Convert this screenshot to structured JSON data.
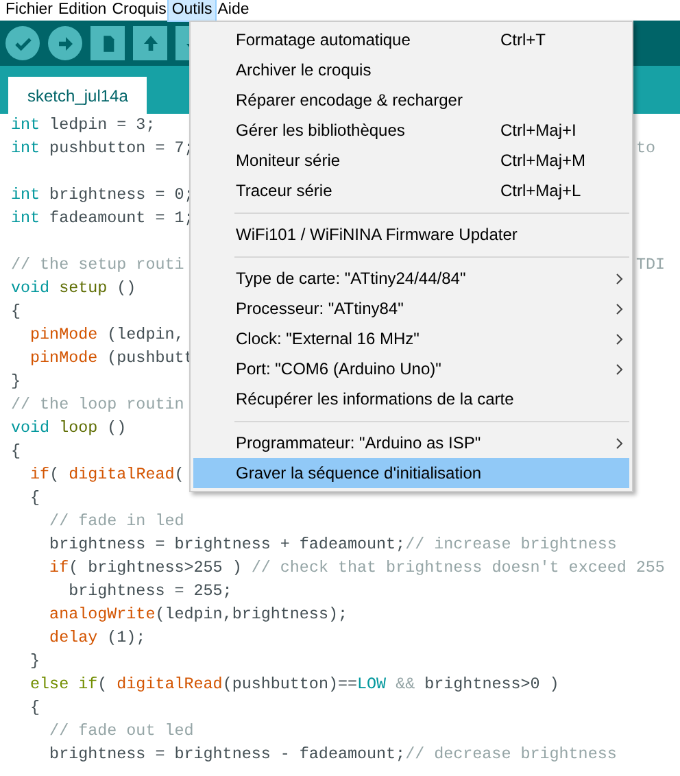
{
  "menubar": [
    {
      "label": "Fichier",
      "selected": false
    },
    {
      "label": "Edition",
      "selected": false
    },
    {
      "label": "Croquis",
      "selected": false
    },
    {
      "label": "Outils",
      "selected": true
    },
    {
      "label": "Aide",
      "selected": false
    }
  ],
  "toolbar": [
    {
      "kind": "verify"
    },
    {
      "kind": "upload"
    },
    {
      "kind": "new"
    },
    {
      "kind": "open"
    },
    {
      "kind": "save"
    }
  ],
  "tabs": [
    {
      "label": "sketch_jul14a",
      "selected": true
    }
  ],
  "code": [
    {
      "kind": "code",
      "left": [
        {
          "text": "int",
          "kind": "type"
        },
        {
          "text": " ledpin = 3;",
          "kind": "plain"
        }
      ]
    },
    {
      "kind": "code",
      "left": [
        {
          "text": "int",
          "kind": "type"
        },
        {
          "text": " pushbutton = 7;",
          "kind": "plain"
        }
      ],
      "right": [
        {
          "text": "to",
          "kind": "comment"
        }
      ]
    },
    {
      "kind": "blank"
    },
    {
      "kind": "code",
      "left": [
        {
          "text": "int",
          "kind": "type"
        },
        {
          "text": " brightness = 0;",
          "kind": "plain"
        }
      ]
    },
    {
      "kind": "code",
      "left": [
        {
          "text": "int",
          "kind": "type"
        },
        {
          "text": " fadeamount = 1;",
          "kind": "plain"
        }
      ]
    },
    {
      "kind": "blank"
    },
    {
      "kind": "code",
      "left": [
        {
          "text": "// the setup routi",
          "kind": "comment"
        }
      ],
      "right": [
        {
          "text": "TDI",
          "kind": "comment"
        }
      ]
    },
    {
      "kind": "code",
      "left": [
        {
          "text": "void ",
          "kind": "type"
        },
        {
          "text": "setup",
          "kind": "func"
        },
        {
          "text": " ()",
          "kind": "plain"
        }
      ]
    },
    {
      "kind": "code",
      "left": [
        {
          "text": "{",
          "kind": "plain"
        }
      ]
    },
    {
      "kind": "code",
      "left": [
        {
          "text": "  pinMode",
          "kind": "builtin"
        },
        {
          "text": " (ledpin,",
          "kind": "plain"
        }
      ]
    },
    {
      "kind": "code",
      "left": [
        {
          "text": "  pinMode",
          "kind": "builtin"
        },
        {
          "text": " (pushbutt",
          "kind": "plain"
        }
      ]
    },
    {
      "kind": "code",
      "left": [
        {
          "text": "}",
          "kind": "plain"
        }
      ]
    },
    {
      "kind": "code",
      "left": [
        {
          "text": "// the loop routin",
          "kind": "comment"
        }
      ]
    },
    {
      "kind": "code",
      "left": [
        {
          "text": "void ",
          "kind": "type"
        },
        {
          "text": "loop",
          "kind": "func"
        },
        {
          "text": " ()",
          "kind": "plain"
        }
      ]
    },
    {
      "kind": "code",
      "left": [
        {
          "text": "{",
          "kind": "plain"
        }
      ]
    },
    {
      "kind": "code",
      "left": [
        {
          "text": "  if",
          "kind": "builtin"
        },
        {
          "text": "( ",
          "kind": "plain"
        },
        {
          "text": "digitalRead",
          "kind": "builtin"
        },
        {
          "text": "(",
          "kind": "plain"
        }
      ]
    },
    {
      "kind": "code",
      "left": [
        {
          "text": "  {",
          "kind": "plain"
        }
      ]
    },
    {
      "kind": "code",
      "left": [
        {
          "text": "    // fade in led",
          "kind": "comment"
        }
      ]
    },
    {
      "kind": "code",
      "left": [
        {
          "text": "    brightness = brightness + fadeamount;",
          "kind": "plain"
        },
        {
          "text": "// increase brightness",
          "kind": "comment"
        }
      ]
    },
    {
      "kind": "code",
      "left": [
        {
          "text": "    if",
          "kind": "builtin"
        },
        {
          "text": "( brightness>255 ) ",
          "kind": "plain"
        },
        {
          "text": "// check that brightness doesn't exceed 255",
          "kind": "comment"
        }
      ]
    },
    {
      "kind": "code",
      "left": [
        {
          "text": "      brightness = 255;",
          "kind": "plain"
        }
      ]
    },
    {
      "kind": "code",
      "left": [
        {
          "text": "    analogWrite",
          "kind": "builtin"
        },
        {
          "text": "(ledpin,brightness);",
          "kind": "plain"
        }
      ]
    },
    {
      "kind": "code",
      "left": [
        {
          "text": "    delay",
          "kind": "builtin"
        },
        {
          "text": " (1);",
          "kind": "plain"
        }
      ]
    },
    {
      "kind": "code",
      "left": [
        {
          "text": "  }",
          "kind": "plain"
        }
      ]
    },
    {
      "kind": "code",
      "left": [
        {
          "text": "  else if",
          "kind": "keyword"
        },
        {
          "text": "( ",
          "kind": "plain"
        },
        {
          "text": "digitalRead",
          "kind": "builtin"
        },
        {
          "text": "(pushbutton)==",
          "kind": "plain"
        },
        {
          "text": "LOW",
          "kind": "type"
        },
        {
          "text": " && ",
          "kind": "comment"
        },
        {
          "text": "brightness>0 )",
          "kind": "plain"
        }
      ]
    },
    {
      "kind": "code",
      "left": [
        {
          "text": "  {",
          "kind": "plain"
        }
      ]
    },
    {
      "kind": "code",
      "left": [
        {
          "text": "    // fade out led",
          "kind": "comment"
        }
      ]
    },
    {
      "kind": "code",
      "left": [
        {
          "text": "    brightness = brightness - fadeamount;",
          "kind": "plain"
        },
        {
          "text": "// decrease brightness",
          "kind": "comment"
        }
      ]
    }
  ],
  "menu": [
    {
      "kind": "item",
      "label": "Formatage automatique",
      "shortcut": "Ctrl+T",
      "submenu": false,
      "selected": false
    },
    {
      "kind": "item",
      "label": "Archiver le croquis",
      "submenu": false,
      "selected": false
    },
    {
      "kind": "item",
      "label": "Réparer encodage & recharger",
      "submenu": false,
      "selected": false
    },
    {
      "kind": "item",
      "label": "Gérer les bibliothèques",
      "shortcut": "Ctrl+Maj+I",
      "submenu": false,
      "selected": false
    },
    {
      "kind": "item",
      "label": "Moniteur série",
      "shortcut": "Ctrl+Maj+M",
      "submenu": false,
      "selected": false
    },
    {
      "kind": "item",
      "label": "Traceur série",
      "shortcut": "Ctrl+Maj+L",
      "submenu": false,
      "selected": false
    },
    {
      "kind": "separator"
    },
    {
      "kind": "item",
      "label": "WiFi101 / WiFiNINA Firmware Updater",
      "submenu": false,
      "selected": false
    },
    {
      "kind": "separator"
    },
    {
      "kind": "item",
      "label": "Type de carte: \"ATtiny24/44/84\"",
      "submenu": true,
      "selected": false
    },
    {
      "kind": "item",
      "label": "Processeur: \"ATtiny84\"",
      "submenu": true,
      "selected": false
    },
    {
      "kind": "item",
      "label": "Clock: \"External 16 MHz\"",
      "submenu": true,
      "selected": false
    },
    {
      "kind": "item",
      "label": "Port: \"COM6 (Arduino Uno)\"",
      "submenu": true,
      "selected": false
    },
    {
      "kind": "item",
      "label": "Récupérer les informations de la carte",
      "submenu": false,
      "selected": false
    },
    {
      "kind": "separator"
    },
    {
      "kind": "item",
      "label": "Programmateur: \"Arduino as ISP\"",
      "submenu": true,
      "selected": false
    },
    {
      "kind": "item",
      "label": "Graver la séquence d'initialisation",
      "submenu": false,
      "selected": true
    }
  ]
}
